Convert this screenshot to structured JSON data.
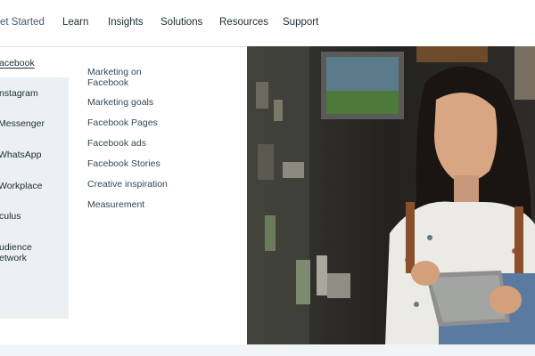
{
  "nav": {
    "items": [
      {
        "label": "et Started",
        "active": true
      },
      {
        "label": "Learn"
      },
      {
        "label": "Insights"
      },
      {
        "label": "Solutions"
      },
      {
        "label": "Resources"
      },
      {
        "label": "Support"
      }
    ]
  },
  "dropdown": {
    "platforms": [
      {
        "label": "acebook",
        "active": true
      },
      {
        "label": "nstagram"
      },
      {
        "label": "Messenger"
      },
      {
        "label": "WhatsApp"
      },
      {
        "label": "Workplace"
      },
      {
        "label": "culus"
      },
      {
        "label": "udience",
        "label2": "etwork"
      }
    ],
    "links": [
      {
        "label": "Marketing on",
        "label2": "Facebook"
      },
      {
        "label": "Marketing goals"
      },
      {
        "label": "Facebook Pages"
      },
      {
        "label": "Facebook ads"
      },
      {
        "label": "Facebook Stories"
      },
      {
        "label": "Creative inspiration"
      },
      {
        "label": "Measurement"
      }
    ]
  },
  "colors": {
    "text": "#1c2b33",
    "panel": "#edf0f2",
    "divider": "#d7dee3"
  },
  "hero": {
    "image": "woman-with-tablet-in-cafe-photo"
  }
}
